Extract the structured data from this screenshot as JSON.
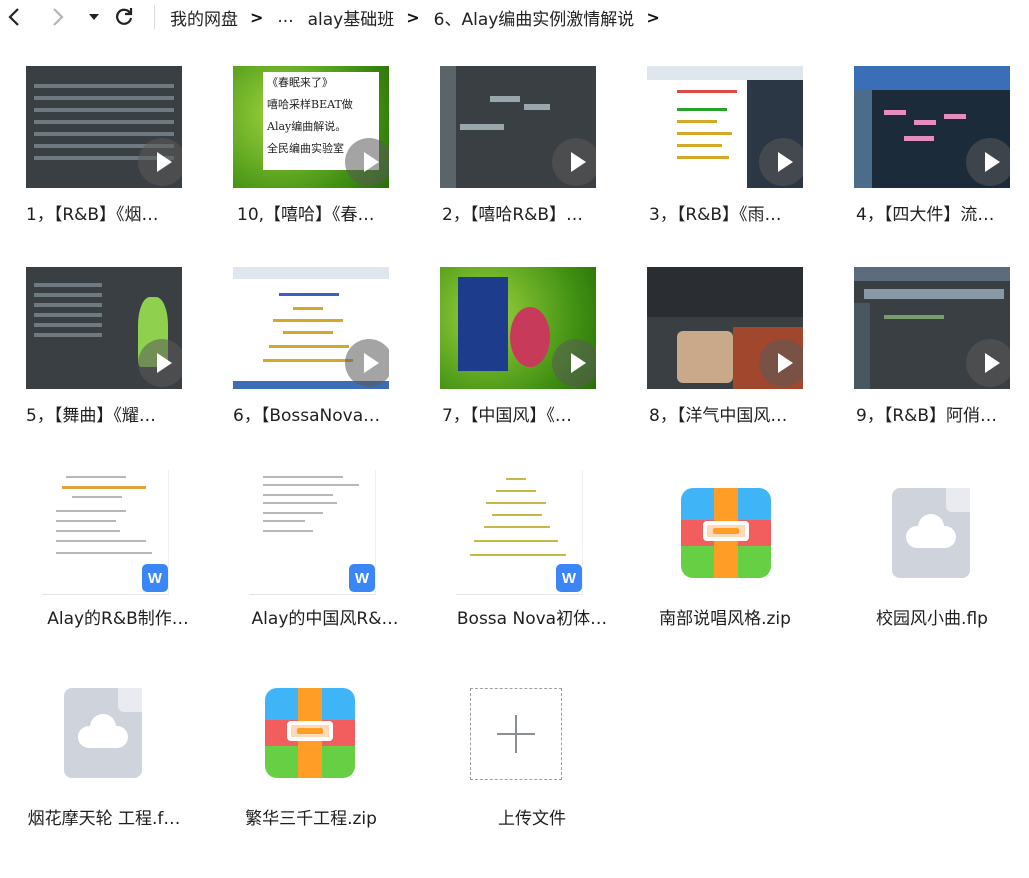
{
  "nav": {
    "back_icon": "chevron-left-icon",
    "forward_icon": "chevron-right-icon",
    "history_icon": "caret-down-icon",
    "refresh_icon": "refresh-icon",
    "breadcrumb": {
      "root": "我的网盘",
      "ellipsis": "...",
      "parent": "alay基础班",
      "current": "6、Alay编曲实例激情解说"
    }
  },
  "videos": [
    {
      "label": "1，【R&B】《烟…",
      "style": "dark"
    },
    {
      "label": "10,【嘻哈】《春…",
      "style": "green-text"
    },
    {
      "label": "2，【嘻哈R&B】…",
      "style": "dark"
    },
    {
      "label": "3，【R&B】《雨…",
      "style": "white-doc"
    },
    {
      "label": "4，【四大件】流…",
      "style": "blue"
    },
    {
      "label": "5，【舞曲】《耀…",
      "style": "dark"
    },
    {
      "label": "6，【BossaNova…",
      "style": "white-doc"
    },
    {
      "label": "7，【中国风】《…",
      "style": "green"
    },
    {
      "label": "8，【洋气中国风…",
      "style": "dark"
    },
    {
      "label": "9，【R&B】阿俏…",
      "style": "dark"
    }
  ],
  "video_thumb_text": {
    "line1": "《春眠来了》",
    "line2": "嘻哈采样BEAT做",
    "line3": "Alay编曲解说。",
    "line4": "全民编曲实验室"
  },
  "docs": [
    {
      "label": "Alay的R&B制作…",
      "badge": "W"
    },
    {
      "label": "Alay的中国风R&…",
      "badge": "W"
    },
    {
      "label": "Bossa Nova初体…",
      "badge": "W"
    }
  ],
  "files": [
    {
      "label": "南部说唱风格.zip",
      "icon": "archive-icon"
    },
    {
      "label": "校园风小曲.flp",
      "icon": "cloud-file-icon"
    },
    {
      "label": "烟花摩天轮 工程.f…",
      "icon": "cloud-file-icon"
    },
    {
      "label": "繁华三千工程.zip",
      "icon": "archive-icon"
    }
  ],
  "upload": {
    "label": "上传文件",
    "icon": "plus-icon"
  }
}
